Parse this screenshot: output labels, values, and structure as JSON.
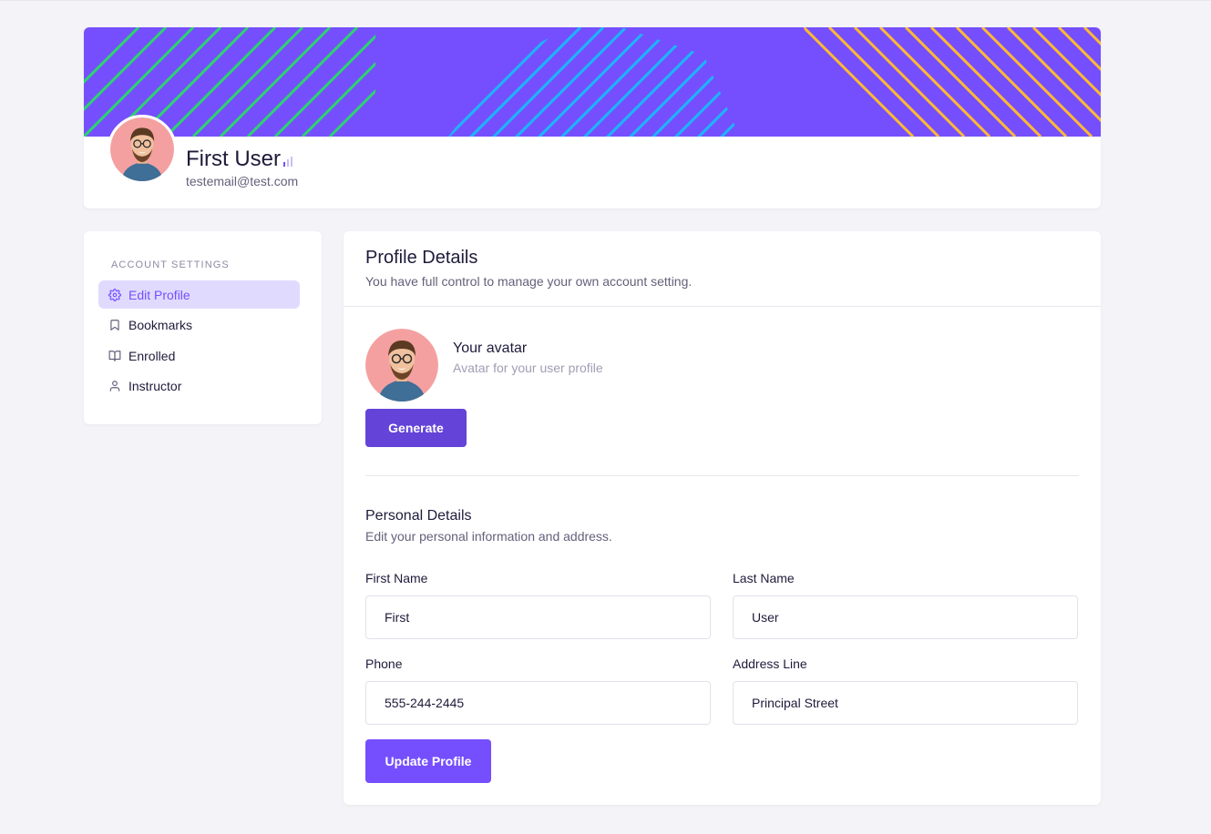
{
  "colors": {
    "primary": "#754ffe",
    "primary_dark": "#6343d8",
    "active_bg": "#e0dbfe",
    "stripe_green": "#2dd36f",
    "stripe_blue": "#1cb5ff",
    "stripe_yellow": "#ffb933",
    "avatar_bg": "#f4a0a0"
  },
  "header": {
    "user_name": "First User",
    "user_email": "testemail@test.com",
    "avatar_icon": "user-avatar-photo"
  },
  "sidebar": {
    "heading": "ACCOUNT SETTINGS",
    "items": [
      {
        "label": "Edit Profile",
        "icon": "gear-icon",
        "active": true
      },
      {
        "label": "Bookmarks",
        "icon": "bookmark-icon",
        "active": false
      },
      {
        "label": "Enrolled",
        "icon": "book-icon",
        "active": false
      },
      {
        "label": "Instructor",
        "icon": "user-icon",
        "active": false
      }
    ]
  },
  "main": {
    "title": "Profile Details",
    "subtitle": "You have full control to manage your own account setting.",
    "avatar_title": "Your avatar",
    "avatar_subtitle": "Avatar for your user profile",
    "generate_label": "Generate",
    "personal_title": "Personal Details",
    "personal_subtitle": "Edit your personal information and address.",
    "fields": {
      "first_name": {
        "label": "First Name",
        "value": "First"
      },
      "last_name": {
        "label": "Last Name",
        "value": "User"
      },
      "phone": {
        "label": "Phone",
        "value": "555-244-2445"
      },
      "address": {
        "label": "Address Line",
        "value": "Principal Street"
      }
    },
    "update_label": "Update Profile"
  }
}
